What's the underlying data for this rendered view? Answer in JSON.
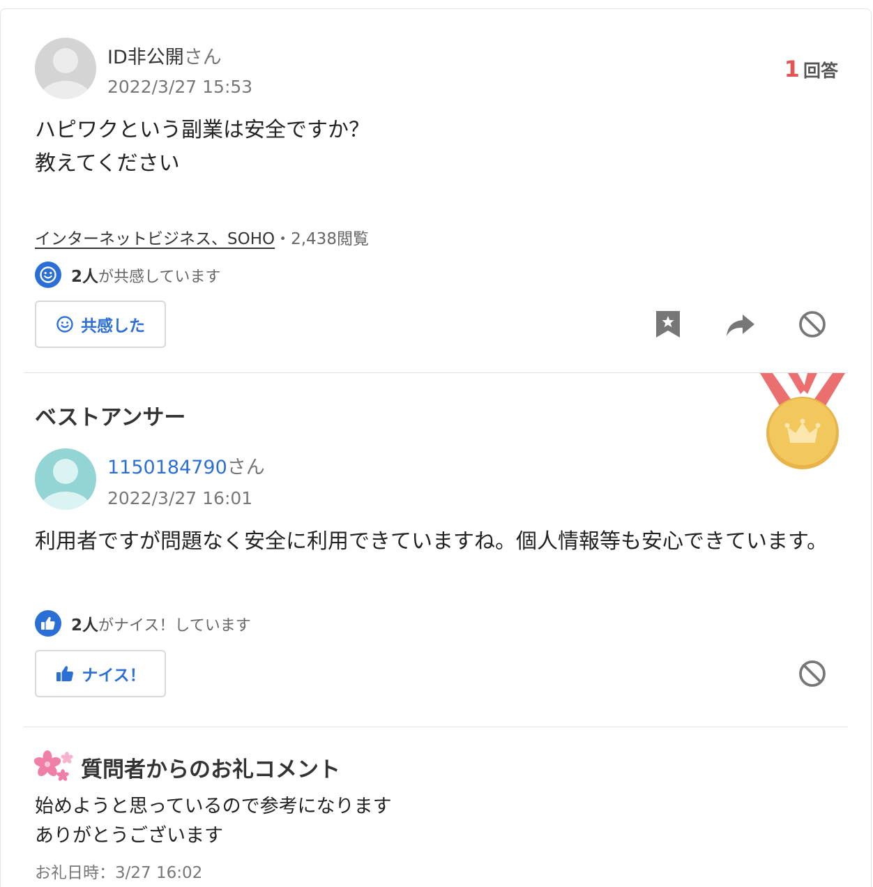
{
  "question": {
    "author": "ID非公開",
    "honorific": "さん",
    "date": "2022/3/27 15:53",
    "answer_count": "1",
    "answer_count_label": "回答",
    "body_lines": [
      "ハピワクという副業は安全ですか？",
      "教えてください"
    ],
    "category": "インターネットビジネス、SOHO",
    "views": "・2,438閲覧",
    "empathy_count": "2人",
    "empathy_suffix": "が共感しています",
    "empathy_button": "共感した",
    "icons": [
      "smile-icon",
      "bookmark-icon",
      "share-icon",
      "block-icon"
    ]
  },
  "best_answer": {
    "heading": "ベストアンサー",
    "author": "1150184790",
    "honorific": "さん",
    "date": "2022/3/27 16:01",
    "body": "利用者ですが問題なく安全に利用できていますね。個人情報等も安心できています。",
    "nice_count": "2人",
    "nice_suffix": "がナイス！しています",
    "nice_button": "ナイス！",
    "icons": [
      "medal-icon",
      "thumbs-up-icon",
      "block-icon"
    ]
  },
  "thanks": {
    "heading": "質問者からのお礼コメント",
    "body_lines": [
      "始めようと思っているので参考になります",
      "ありがとうございます"
    ],
    "date": "お礼日時：3/27 16:02",
    "icons": [
      "sakura-icon"
    ]
  },
  "colors": {
    "accent": "#2b6fd6",
    "count_red": "#e05555",
    "medal_gold": "#f2c75b",
    "ribbon_red": "#ec6f6f"
  }
}
